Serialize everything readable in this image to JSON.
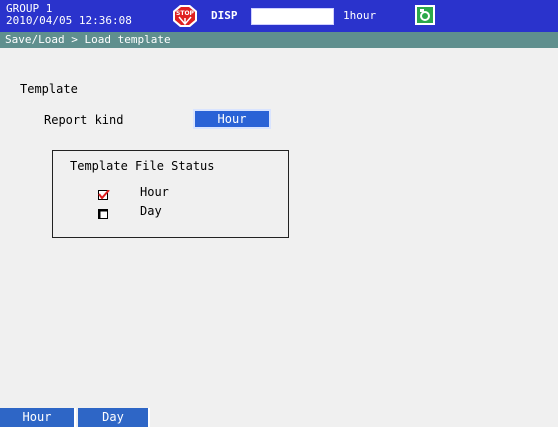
{
  "status_bar": {
    "group": "GROUP 1",
    "datetime": "2010/04/05 12:36:08",
    "stop_icon": "stop-icon",
    "disp_label": "DISP",
    "interval": "1hour",
    "camera_icon": "camera-icon"
  },
  "breadcrumb": "Save/Load > Load template",
  "main": {
    "section_title": "Template",
    "report_kind_label": "Report kind",
    "report_kind_value": "Hour",
    "status_panel": {
      "title": "Template File Status",
      "items": [
        {
          "label": "Hour",
          "checked": true
        },
        {
          "label": "Day",
          "checked": false
        }
      ]
    }
  },
  "softkeys": [
    {
      "label": "Hour"
    },
    {
      "label": "Day"
    }
  ],
  "colors": {
    "status_bar_bg": "#2a33cc",
    "breadcrumb_bg": "#5f8f8e",
    "selected_value_bg": "#2a62d6",
    "softkey_bg": "#2e66c6"
  }
}
